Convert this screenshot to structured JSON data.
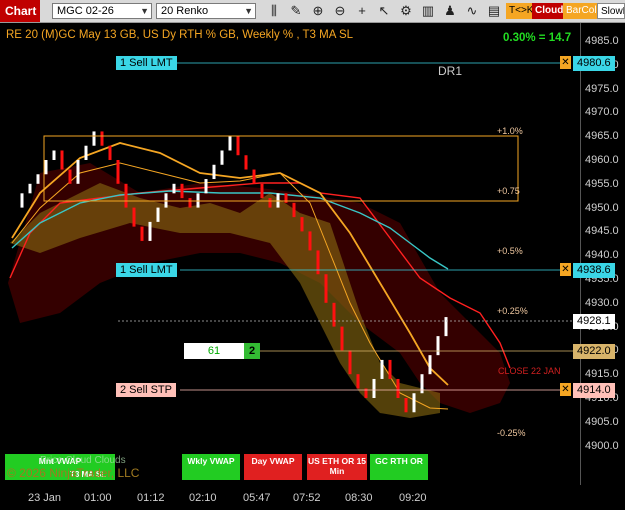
{
  "toolbar": {
    "chart_tab": "Chart",
    "instrument": "MGC 02-26",
    "bar_type": "20 Renko",
    "icons": [
      "bar-style-icon",
      "draw-tool-icon",
      "zoom-in-icon",
      "zoom-out-icon",
      "crosshair-icon",
      "cursor-icon",
      "properties-icon",
      "hide-icon",
      "strategy-icon",
      "indicator-icon",
      "data-box-icon"
    ],
    "tk_label": "T<>K",
    "cloud_label": "Cloud",
    "barcol_label": "BarCol",
    "slowm_label": "SlowM"
  },
  "chart": {
    "title": "RE 20  (M)GC May 13 GB, US Dy RTH % GB, Weekly % , T3 MA SL",
    "stat": "0.30% = 14.7",
    "dr_label": "DR1",
    "close_label": "CLOSE 22 JAN",
    "copyright": "© 2026 NinjaTrader, LLC",
    "price_cloud_label": "Price    Cloud Clouds",
    "colors": {
      "bull": "#ffffff",
      "bear": "#ff0000",
      "accent": "#f5a623",
      "vwap": "#39c6c6"
    }
  },
  "y_axis": {
    "ticks": [
      "4985.0",
      "4980.0",
      "4975.0",
      "4970.0",
      "4965.0",
      "4960.0",
      "4955.0",
      "4950.0",
      "4945.0",
      "4940.0",
      "4935.0",
      "4930.0",
      "4925.0",
      "4920.0",
      "4915.0",
      "4910.0",
      "4905.0",
      "4900.0"
    ]
  },
  "x_axis": {
    "ticks": [
      "23 Jan",
      "01:00",
      "01:12",
      "02:10",
      "05:47",
      "07:52",
      "08:30",
      "09:20"
    ]
  },
  "orders": [
    {
      "label": "1 Sell LMT",
      "price": "4980.6"
    },
    {
      "label": "1 Sell LMT",
      "price": "4938.6"
    },
    {
      "label": "2 Sell STP",
      "price": "4914.0"
    }
  ],
  "last_price": "4928.1",
  "position_qty": "2",
  "position_pnl": "61",
  "position_price": "4922.0",
  "pct_levels": [
    "+1.0%",
    "+0.75",
    "+0.5%",
    "+0.25%",
    "-0.25%"
  ],
  "buttons": {
    "mnt_vwap": "Mnt VWAP",
    "t3_ma_sl": "T3 MA SL",
    "wkly_vwap": "Wkly VWAP",
    "day_vwap": "Day VWAP",
    "us_eth_or": "US ETH OR 15 Min",
    "gc_rth_or": "GC RTH OR"
  }
}
